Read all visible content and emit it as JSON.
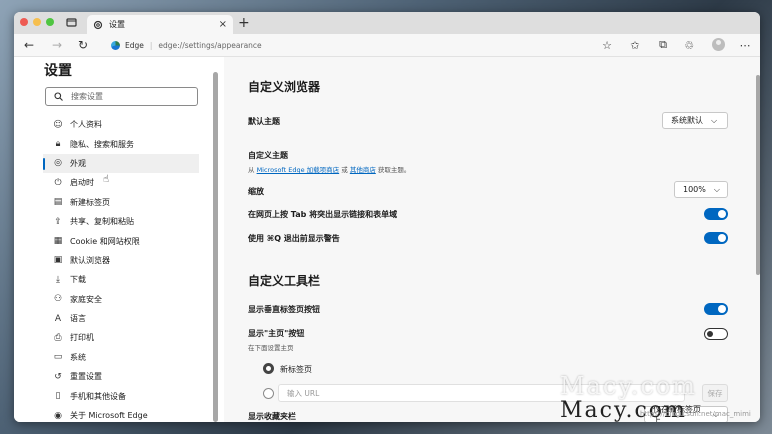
{
  "browser": {
    "tab_title": "设置",
    "address_brand": "Edge",
    "address_url": "edge://settings/appearance"
  },
  "sidebar": {
    "title": "设置",
    "search_placeholder": "搜索设置",
    "items": [
      {
        "label": "个人资料",
        "icon": "profile-icon"
      },
      {
        "label": "隐私、搜索和服务",
        "icon": "lock-icon"
      },
      {
        "label": "外观",
        "icon": "palette-icon",
        "active": true
      },
      {
        "label": "启动时",
        "icon": "power-icon"
      },
      {
        "label": "新建标签页",
        "icon": "newtab-icon"
      },
      {
        "label": "共享、复制和粘贴",
        "icon": "share-icon"
      },
      {
        "label": "Cookie 和网站权限",
        "icon": "cookie-icon"
      },
      {
        "label": "默认浏览器",
        "icon": "browser-icon"
      },
      {
        "label": "下载",
        "icon": "download-icon"
      },
      {
        "label": "家庭安全",
        "icon": "family-icon"
      },
      {
        "label": "语言",
        "icon": "language-icon"
      },
      {
        "label": "打印机",
        "icon": "printer-icon"
      },
      {
        "label": "系统",
        "icon": "system-icon"
      },
      {
        "label": "重置设置",
        "icon": "reset-icon"
      },
      {
        "label": "手机和其他设备",
        "icon": "phone-icon"
      },
      {
        "label": "关于 Microsoft Edge",
        "icon": "edge-icon"
      }
    ]
  },
  "main": {
    "section1_title": "自定义浏览器",
    "default_theme_label": "默认主题",
    "default_theme_value": "系统默认",
    "custom_theme_label": "自定义主题",
    "custom_theme_prefix": "从",
    "custom_theme_link1": "Microsoft Edge 加载项商店",
    "custom_theme_or": "或",
    "custom_theme_link2": "其他商店",
    "custom_theme_suffix": "获取主题。",
    "zoom_label": "缩放",
    "zoom_value": "100%",
    "tab_highlight_label": "在网页上按 Tab 将突出显示链接和表单域",
    "tab_highlight_on": true,
    "quit_warning_label": "使用 ⌘Q 退出前显示警告",
    "quit_warning_on": true,
    "section2_title": "自定义工具栏",
    "vertical_tabs_label": "显示垂直标签页按钮",
    "vertical_tabs_on": true,
    "home_button_label": "显示\"主页\"按钮",
    "home_button_on": false,
    "home_button_sub": "在下面设置主页",
    "radio_newtab_label": "新标签页",
    "url_placeholder": "输入 URL",
    "save_label": "保存",
    "favorites_bar_label": "显示收藏夹栏",
    "favorites_bar_value": "仅在新标签页上"
  },
  "watermark": {
    "text1": "Macy.com",
    "text2": "Macy.com",
    "small": "https://blog.csdn.net/mac_mimi"
  },
  "colors": {
    "accent": "#0067c0",
    "traffic_red": "#ee5b53",
    "traffic_yellow": "#f6bf4f",
    "traffic_green": "#4fc541"
  }
}
